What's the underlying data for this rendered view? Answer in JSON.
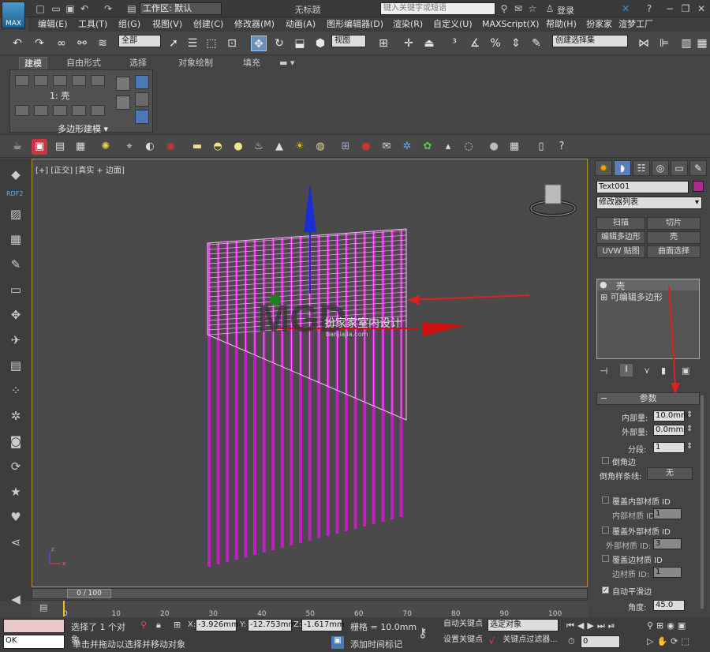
{
  "app": {
    "logo": "MAX",
    "workspace": "工作区: 默认",
    "title": "无标题",
    "search_placeholder": "键入关键字或短语",
    "login": "登录"
  },
  "menu": [
    "编辑(E)",
    "工具(T)",
    "组(G)",
    "视图(V)",
    "创建(C)",
    "修改器(M)",
    "动画(A)",
    "图形编辑器(D)",
    "渲染(R)",
    "自定义(U)",
    "MAXScript(X)",
    "帮助(H)",
    "扮家家",
    "渲梦工厂"
  ],
  "toolbar": {
    "filter": "全部",
    "view": "视图",
    "selection_set": "创建选择集"
  },
  "ribbon": {
    "tabs": [
      "建模",
      "自由形式",
      "选择",
      "对象绘制",
      "填充"
    ],
    "level": "1: 壳",
    "group": "多边形建模"
  },
  "leftbar": {
    "rdf": "RDF2"
  },
  "viewport": {
    "label": "[+] [正交] [真实 + 边面]",
    "watermark_main": "MGD",
    "watermark_sub": "扮家家室内设计",
    "watermark_url": "banjiajia.com"
  },
  "timeline": {
    "slider": "0 / 100",
    "ticks": [
      "0",
      "10",
      "20",
      "30",
      "40",
      "50",
      "60",
      "70",
      "80",
      "90",
      "100"
    ]
  },
  "status": {
    "listener": "OK",
    "selected": "选择了 1 个对象",
    "hint": "单击并拖动以选择并移动对象",
    "x_label": "X:",
    "x": "-3.926mm",
    "y_label": "Y:",
    "y": "-12.753mm",
    "z_label": "Z:",
    "z": "-1.617mm",
    "grid": "栅格 = 10.0mm",
    "add_time_tag": "添加时间标记",
    "auto_key": "自动关键点",
    "set_key": "设置关键点",
    "key_mode": "选定对象",
    "key_filter": "关键点过滤器...",
    "frame": "0"
  },
  "panel": {
    "object_name": "Text001",
    "object_color": "#b0278f",
    "modifier_list": "修改器列表",
    "buttons": [
      "扫描",
      "切片",
      "编辑多边形",
      "壳",
      "UVW 贴图",
      "曲面选择"
    ],
    "stack": [
      "壳",
      "可编辑多边形"
    ],
    "rollout": "参数",
    "inner_label": "内部量:",
    "inner": "10.0mm",
    "outer_label": "外部量:",
    "outer": "0.0mm",
    "segments_label": "分段:",
    "segments": "1",
    "bevel_edges": "倒角边",
    "bevel_spline_label": "倒角样条线:",
    "bevel_spline": "无",
    "override_inner": "覆盖内部材质 ID",
    "inner_id_label": "内部材质 ID:",
    "inner_id": "1",
    "override_outer": "覆盖外部材质 ID",
    "outer_id_label": "外部材质 ID:",
    "outer_id": "3",
    "override_edge": "覆盖边材质 ID",
    "edge_id_label": "边材质 ID:",
    "edge_id": "1",
    "auto_smooth": "自动平滑边",
    "angle_label": "角度:",
    "angle": "45.0"
  },
  "colors": {
    "accent": "#b78f21",
    "object": "#c020c0",
    "bg": "#444444"
  }
}
